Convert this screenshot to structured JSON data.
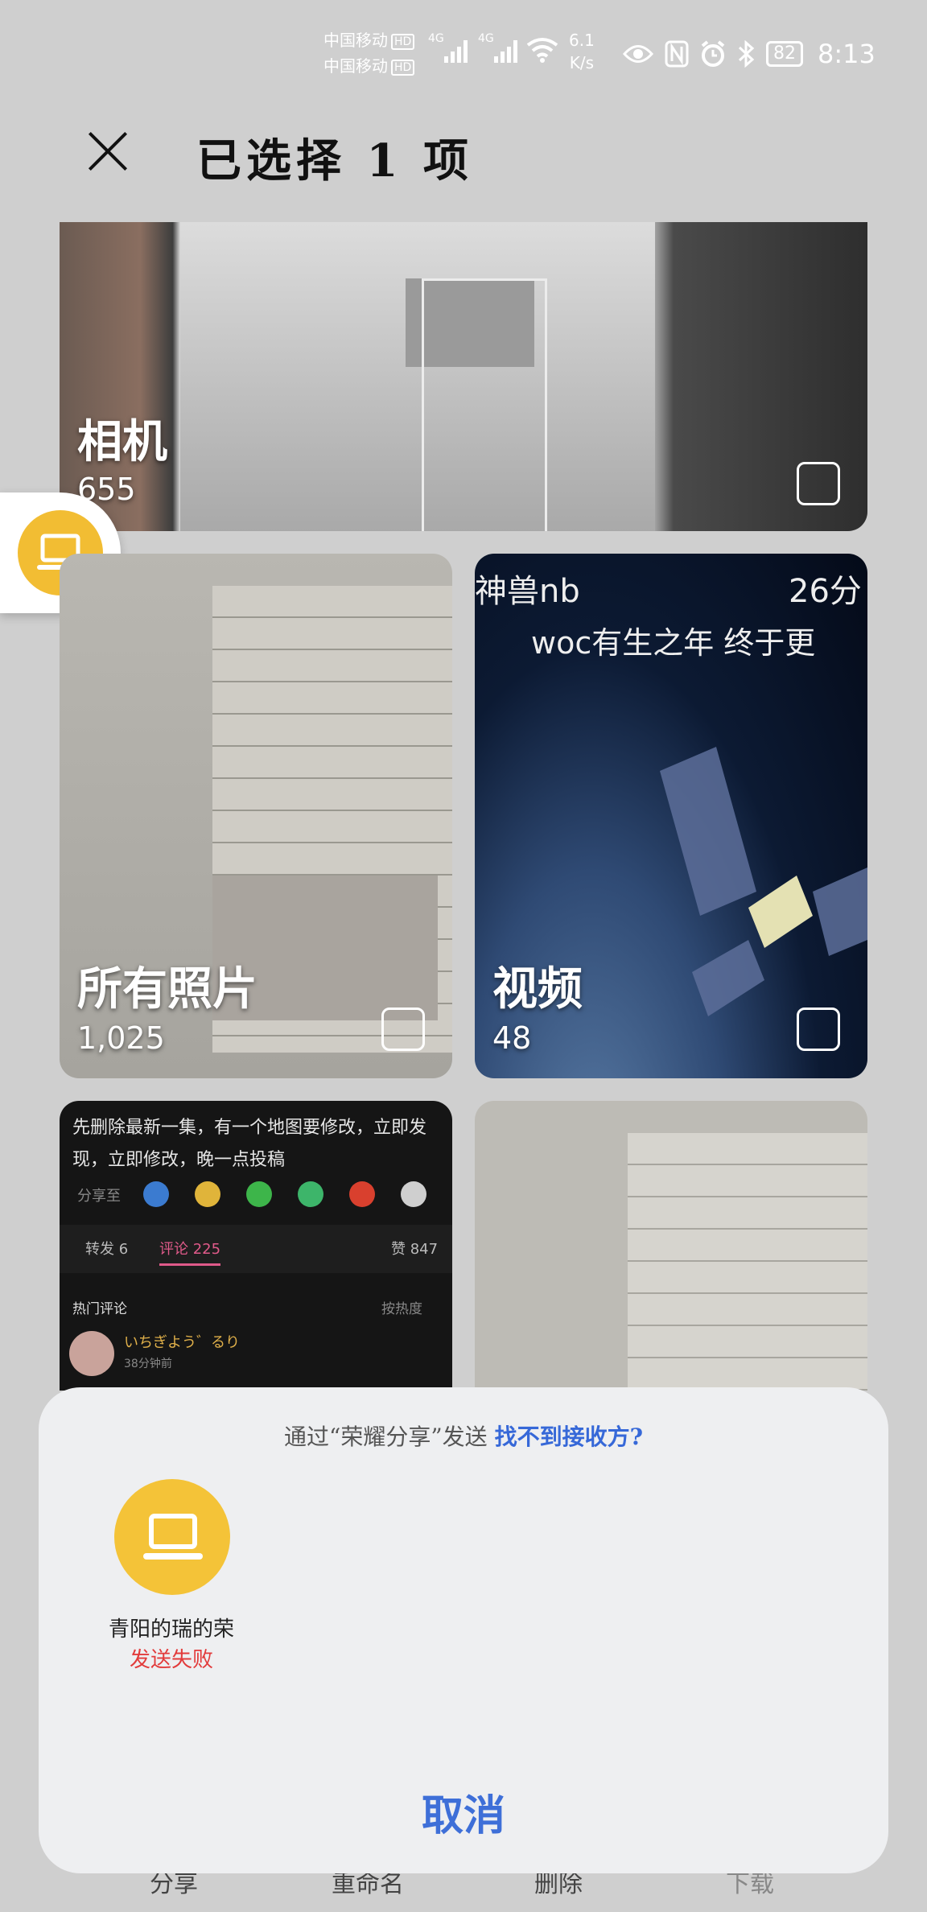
{
  "status_bar": {
    "carrier1": "中国移动",
    "carrier2": "中国移动",
    "hd_badge": "HD",
    "net_type": "4G",
    "speed_value": "6.1",
    "speed_unit": "K/s",
    "battery": "82",
    "time": "8:13",
    "icons": [
      "eye-icon",
      "nfc-icon",
      "alarm-icon",
      "bluetooth-icon"
    ]
  },
  "header": {
    "title": "已选择 1 项"
  },
  "albums": [
    {
      "name": "相机",
      "count": "655"
    },
    {
      "name": "所有照片",
      "count": "1,025"
    },
    {
      "name": "视频",
      "count": "48"
    }
  ],
  "video_overlay": {
    "line1": "神兽nb",
    "line1_right": "26分",
    "line2": "woc有生之年  终于更"
  },
  "screenshot_tile": {
    "text": "先删除最新一集，有一个地图要修改，立即发现，立即修改，晚一点投稿",
    "share_label": "分享至",
    "tab_repost": "转发 6",
    "tab_comment": "评论 225",
    "likes": "赞 847",
    "hot_comments": "热门评论",
    "sort": "按热度",
    "commenter": "いちぎよう゛るり",
    "comment_time": "38分钟前"
  },
  "share_sheet": {
    "via_text": "通过“荣耀分享”发送",
    "help_link": "找不到接收方?",
    "device_name": "青阳的瑞的荣",
    "device_status": "发送失败",
    "cancel": "取消",
    "colors": {
      "accent": "#3e6fd8",
      "error": "#e23b3b",
      "device": "#f4c338"
    }
  },
  "bottom_tabs": [
    "分享",
    "重命名",
    "删除",
    "下载"
  ]
}
